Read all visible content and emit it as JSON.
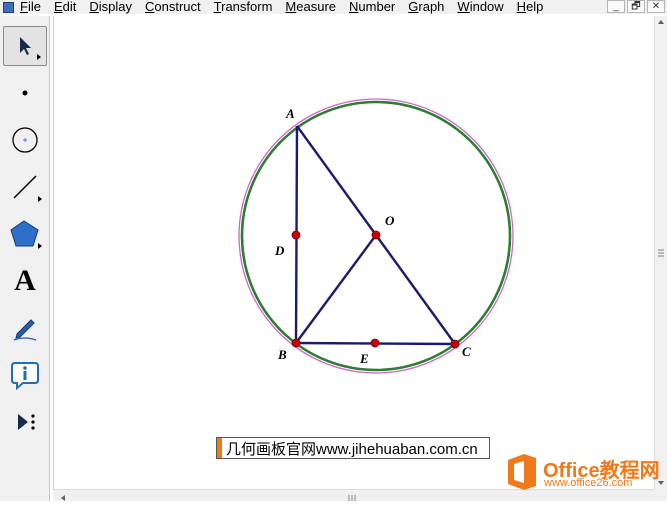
{
  "menubar": {
    "items": [
      "File",
      "Edit",
      "Display",
      "Construct",
      "Transform",
      "Measure",
      "Number",
      "Graph",
      "Window",
      "Help"
    ],
    "window_buttons": [
      "_",
      "🗗",
      "✕"
    ]
  },
  "toolbar": {
    "tools": [
      "arrow-tool",
      "point-tool",
      "compass-tool",
      "straightedge-tool",
      "polygon-tool",
      "text-tool",
      "marker-tool",
      "information-tool",
      "custom-tool"
    ],
    "text_tool_glyph": "A"
  },
  "figure": {
    "labels": {
      "A": "A",
      "B": "B",
      "C": "C",
      "D": "D",
      "E": "E",
      "O": "O"
    },
    "colors": {
      "segment": "#1b1b6e",
      "circle_outer": "#cc66cc",
      "circle_inner": "#2e7d32",
      "point": "#cc0000"
    }
  },
  "watermark": {
    "text": "几何画板官网www.jihehuaban.com.cn"
  },
  "logo": {
    "brand": "Office教程网",
    "url": "www.office26.com"
  }
}
